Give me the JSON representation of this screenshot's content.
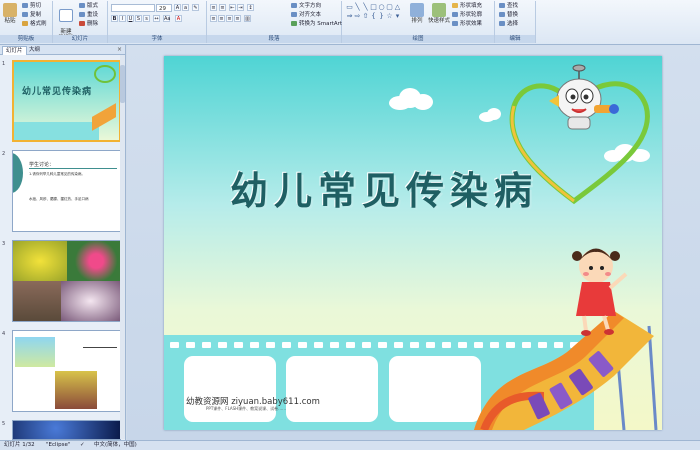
{
  "ribbon": {
    "clipboard": {
      "label": "剪贴板",
      "paste": "粘贴",
      "cut": "剪切",
      "copy": "复制",
      "format_painter": "格式刷"
    },
    "slides": {
      "label": "幻灯片",
      "new_slide": "新建\n幻灯片",
      "layout": "版式",
      "reset": "重设",
      "delete": "删除"
    },
    "font": {
      "label": "字体",
      "font_size": "29"
    },
    "paragraph": {
      "label": "段落",
      "text_direction": "文字方向",
      "align_text": "对齐文本",
      "smartart": "转换为 SmartArt"
    },
    "drawing": {
      "label": "绘图",
      "arrange": "排列",
      "quick_styles": "快速样式",
      "shape_fill": "形状填充",
      "shape_outline": "形状轮廓",
      "shape_effects": "形状效果"
    },
    "editing": {
      "label": "编辑",
      "find": "查找",
      "replace": "替换",
      "select": "选择"
    }
  },
  "pane": {
    "tab_slides": "幻灯片",
    "tab_outline": "大纲",
    "close": "×",
    "thumbnails": [
      {
        "number": "1",
        "title": "幼儿常见传染病"
      },
      {
        "number": "2",
        "heading": "学生讨论：",
        "line1": "1.请你列举几种儿童常见的传染病。",
        "line2": "水痘、风疹、腮腺、猩红热、手足口病"
      },
      {
        "number": "3"
      },
      {
        "number": "4"
      },
      {
        "number": "5"
      }
    ]
  },
  "slide": {
    "title": "幼儿常见传染病",
    "watermark": "幼教资源网 ziyuan.baby611.com",
    "watermark_sub": "PPT课件、FLASH课件、教案说课、试卷……"
  },
  "status": {
    "slide_count": "幻灯片 1/32",
    "theme": "\"Eclipse\"",
    "language": "中文(简体，中国)"
  },
  "colors": {
    "title_text": "#1f5f63",
    "slide_top": "#4fd4d4",
    "selection": "#f2b233"
  }
}
